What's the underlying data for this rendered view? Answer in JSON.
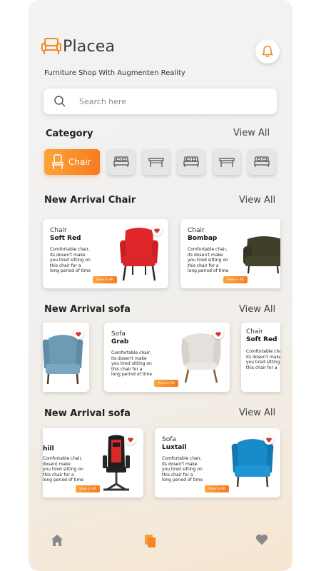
{
  "app": {
    "name": "Placea",
    "tagline": "Furniture Shop With Augmenten Reality"
  },
  "search": {
    "placeholder": "Search here"
  },
  "category": {
    "title": "Category",
    "view_all": "View All",
    "active": {
      "label": "Chair",
      "icon": "chair-icon"
    },
    "others": [
      "bed-icon",
      "table-icon",
      "bed-icon",
      "table-icon",
      "bed-icon"
    ]
  },
  "sections": [
    {
      "title": "New Arrival Chair",
      "view_all": "View All",
      "cards": [
        {
          "type": "Chair",
          "name": "Soft Red",
          "desc": "Comfortable chair, its dosen't make you tired sitting on this chair for a long period of time",
          "button": "View in AR"
        },
        {
          "type": "Chair",
          "name": "Bombap",
          "desc": "Comfortable chair, its dosen't make you tired sitting on this chair for a long period of time",
          "button": "View in AR"
        }
      ]
    },
    {
      "title": "New Arrival sofa",
      "view_all": "View All",
      "cards": [
        {
          "type": "Sofa",
          "name": "Grab",
          "desc": "Comfortable chair, its dosen't make you tired sitting on this chair for a long period of time",
          "button": "View in AR"
        },
        {
          "type": "Chair",
          "name": "Soft Red",
          "desc": "Comfortable chair, its dosen't make you tired sitting on this chair for a"
        }
      ]
    },
    {
      "title": "New Arrival sofa",
      "view_all": "View All",
      "cards": [
        {
          "name_partial": "hill",
          "desc_lines": [
            "Comfortable chair,",
            "dosent make",
            "you tired sitting on",
            "this chair for a",
            "long period of time"
          ],
          "button": "View in AR"
        },
        {
          "type": "Sofa",
          "name": "Luxtail",
          "desc": "Comfortable chair, its dosen't make you tired sitting on this chair for a long period of time",
          "button": "View in AR"
        }
      ]
    }
  ],
  "bottom_nav": [
    "home-icon",
    "copy-icon",
    "heart-icon"
  ],
  "colors": {
    "accent": "#f7851f",
    "accent_light": "#fba53b",
    "heart": "#d9353a"
  }
}
